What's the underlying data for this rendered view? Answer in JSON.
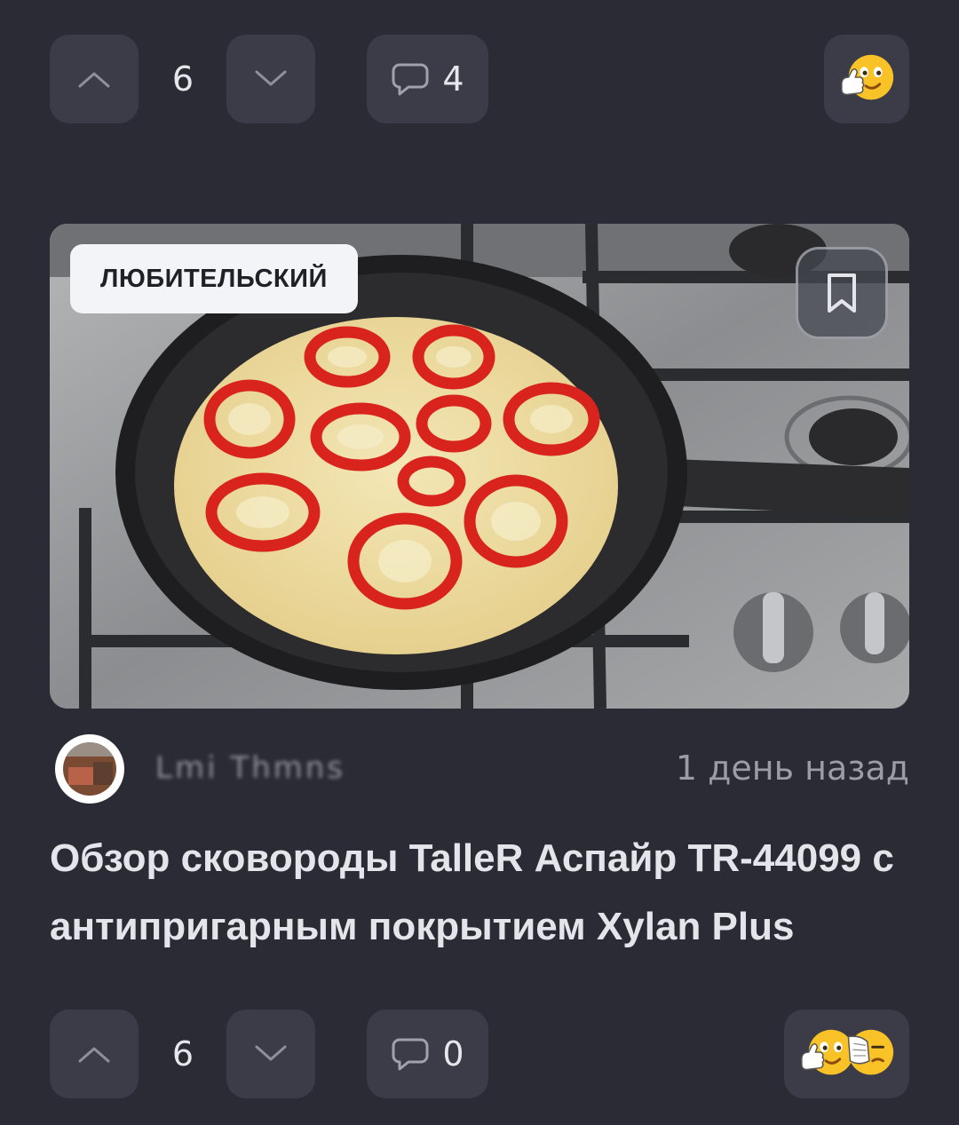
{
  "top_actions": {
    "vote_count": "6",
    "comment_count": "4",
    "reactions": [
      "thumbs-up-emoji"
    ]
  },
  "post": {
    "badge": "ЛЮБИТЕЛЬСКИЙ",
    "author": "Lmi Thmns",
    "time": "1 день назад",
    "title": "Обзор сковороды TalleR Аспайр TR-44099 с антипригарным покрытием Xylan Plus"
  },
  "bottom_actions": {
    "vote_count": "6",
    "comment_count": "0",
    "reactions": [
      "thumbs-up-emoji",
      "facepalm-emoji"
    ]
  },
  "colors": {
    "background": "#2a2b35",
    "button": "#3b3c47",
    "badge": "#f2f4f7",
    "pepper": "#d8241c",
    "cheese": "#eddca0"
  }
}
